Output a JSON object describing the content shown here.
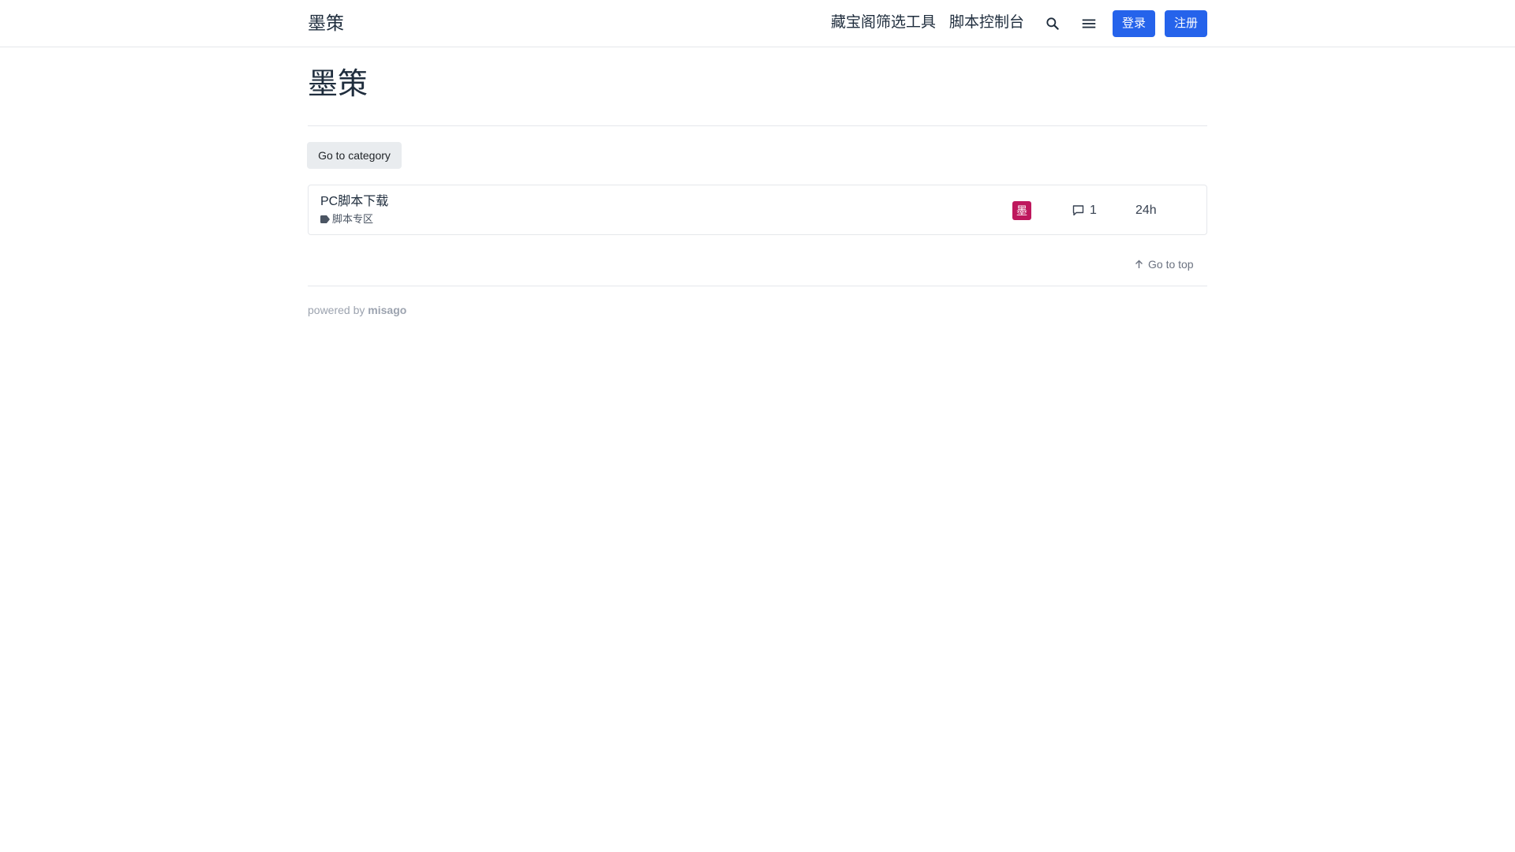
{
  "navbar": {
    "brand": "墨策",
    "links": [
      {
        "label": "藏宝阁筛选工具"
      },
      {
        "label": "脚本控制台"
      }
    ],
    "icons": {
      "search": "search-icon",
      "menu": "menu-icon"
    },
    "login_label": "登录",
    "register_label": "注册",
    "accent_color": "#2563eb"
  },
  "page": {
    "title": "墨策",
    "goto_category_label": "Go to category"
  },
  "threads": [
    {
      "title": "PC脚本下载",
      "category": "脚本专区",
      "avatar_letter": "墨",
      "avatar_color": "#be185d",
      "replies": "1",
      "last_activity": "24h"
    }
  ],
  "go_top_label": "Go to top",
  "footer": {
    "powered_by": "powered by",
    "product": "misago"
  }
}
